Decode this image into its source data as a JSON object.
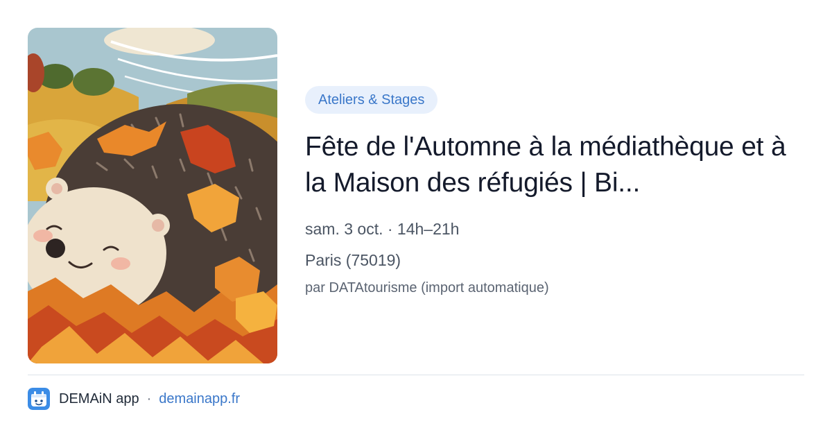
{
  "card": {
    "image_alt": "Illustration d'un hérisson souriant dans des feuilles d'automne",
    "category": "Ateliers & Stages",
    "title": "Fête de l'Automne à la médiathèque et à la Maison des réfugiés | Bi...",
    "date": "sam. 3 oct. · 14h–21h",
    "location": "Paris (75019)",
    "source": "par DATAtourisme (import automatique)"
  },
  "footer": {
    "app_name": "DEMAiN app",
    "separator": "·",
    "domain": "demainapp.fr",
    "logo_icon": "demain-app-logo-icon"
  },
  "colors": {
    "badge_bg": "#e8f0fc",
    "accent": "#3a77c9",
    "title": "#141a2b",
    "muted": "#4b5563"
  }
}
